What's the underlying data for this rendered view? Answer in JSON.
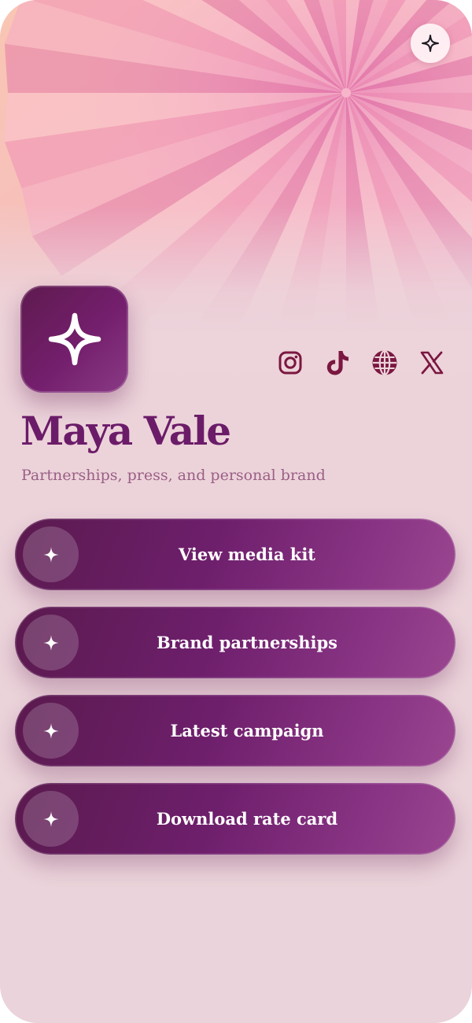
{
  "profile": {
    "name": "Maya Vale",
    "tagline": "Partnerships, press, and personal brand"
  },
  "corner_action": {
    "icon": "sparkle-icon"
  },
  "avatar": {
    "icon": "sparkle-icon"
  },
  "socials": [
    {
      "network": "Instagram",
      "icon": "instagram-icon"
    },
    {
      "network": "TikTok",
      "icon": "tiktok-icon"
    },
    {
      "network": "Website",
      "icon": "globe-icon"
    },
    {
      "network": "X",
      "icon": "x-icon"
    }
  ],
  "links": [
    {
      "label": "View media kit",
      "icon": "sparkle-icon"
    },
    {
      "label": "Brand partnerships",
      "icon": "sparkle-icon"
    },
    {
      "label": "Latest campaign",
      "icon": "sparkle-icon"
    },
    {
      "label": "Download rate card",
      "icon": "sparkle-icon"
    }
  ],
  "colors": {
    "accent": "#6b1c68",
    "button_gradient_start": "#5a1a4e",
    "button_gradient_end": "#9a4690",
    "social_icon": "#7a1740",
    "background": "#ecd3da"
  }
}
